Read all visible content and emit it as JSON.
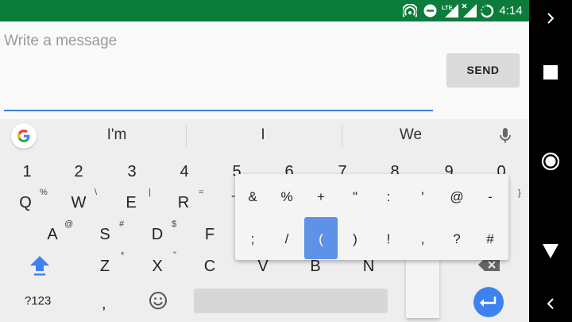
{
  "status_bar": {
    "time": "4:14",
    "icons": [
      "hotspot-icon",
      "do-not-disturb-icon",
      "lte-signal-icon",
      "no-signal-icon",
      "battery-icon"
    ],
    "lte_label": "LTE",
    "background": "#0c7c3c"
  },
  "compose": {
    "placeholder": "Write a message",
    "send_label": "SEND",
    "accent": "#3b7fd4"
  },
  "suggestions": [
    "I'm",
    "I",
    "We"
  ],
  "keyboard": {
    "number_row": [
      "1",
      "2",
      "3",
      "4",
      "5",
      "6",
      "7",
      "8",
      "9",
      "0"
    ],
    "row1": [
      {
        "key": "Q",
        "hint": "%"
      },
      {
        "key": "W",
        "hint": "\\"
      },
      {
        "key": "E",
        "hint": "|"
      },
      {
        "key": "R",
        "hint": "="
      },
      {
        "key": "",
        "hint": "}"
      }
    ],
    "row2": [
      {
        "key": "A",
        "hint": "@"
      },
      {
        "key": "S",
        "hint": "#"
      },
      {
        "key": "D",
        "hint": "$"
      },
      {
        "key": "F",
        "hint": ""
      }
    ],
    "row3": [
      {
        "key": "Z",
        "hint": "*"
      },
      {
        "key": "X",
        "hint": "\""
      },
      {
        "key": "C",
        "hint": ""
      },
      {
        "key": "V",
        "hint": ""
      },
      {
        "key": "B",
        "hint": ""
      },
      {
        "key": "N",
        "hint": ""
      }
    ],
    "symbols_label": "?123",
    "comma": ",",
    "enter_color": "#3d82f0",
    "popup": {
      "row1": [
        "&",
        "%",
        "+",
        "\"",
        ":",
        "'",
        "@",
        "-"
      ],
      "row2": [
        ";",
        "/",
        "(",
        ")",
        "!",
        ",",
        "?",
        "#"
      ],
      "selected": "(",
      "selected_color": "#5d92e8",
      "left_fragment": "-"
    }
  },
  "nav_bar": {
    "icons": [
      "chevron-right-icon",
      "recents-square-icon",
      "home-circle-icon",
      "back-triangle-icon",
      "chevron-left-icon"
    ]
  }
}
